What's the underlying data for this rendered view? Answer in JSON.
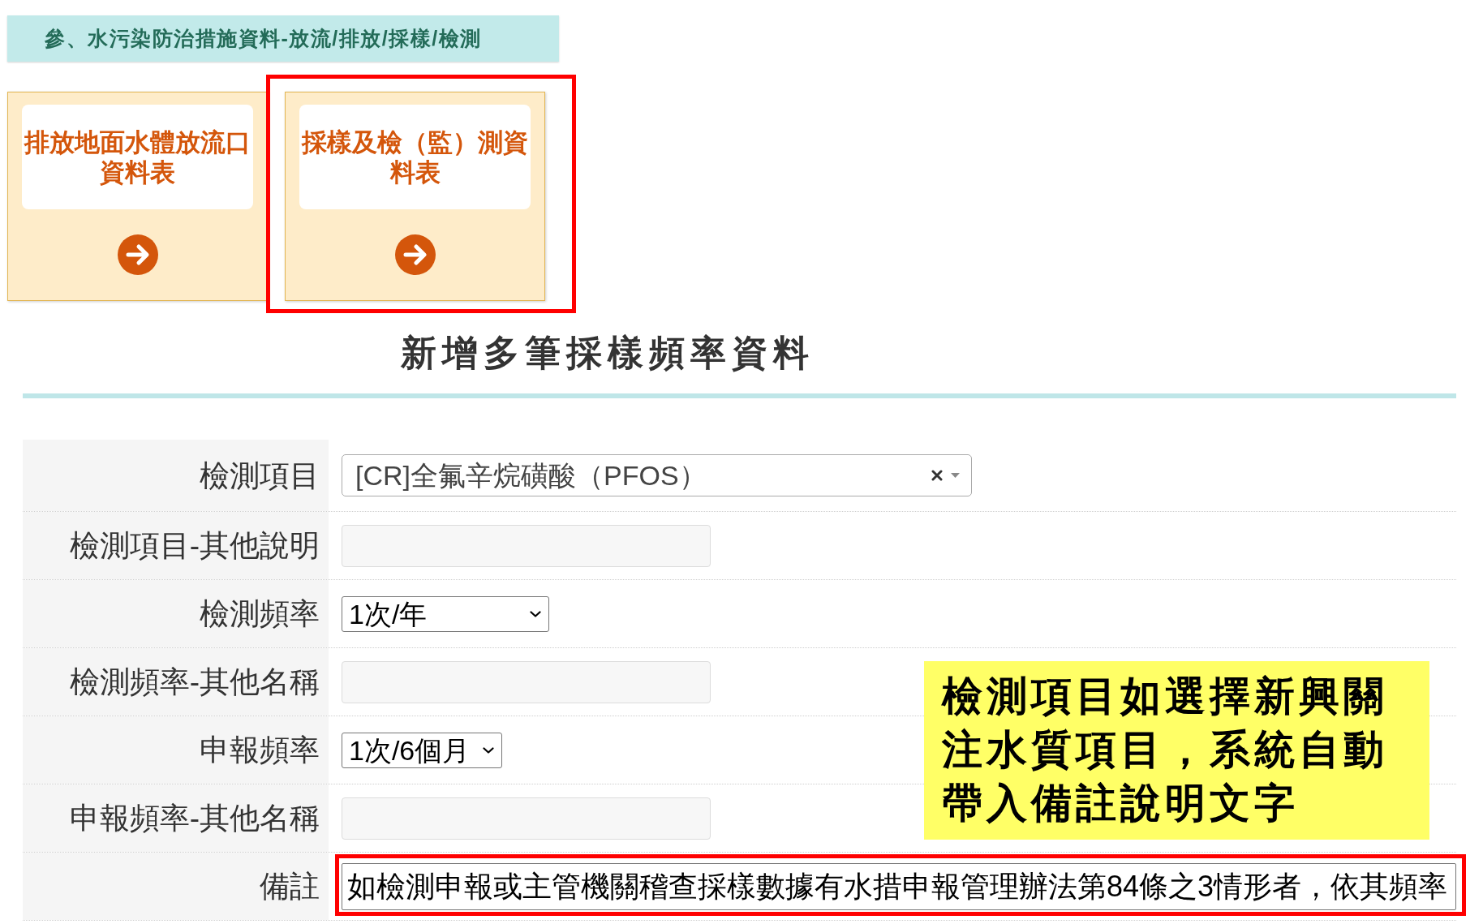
{
  "section_header": "參、水污染防治措施資料-放流/排放/採樣/檢測",
  "cards": [
    {
      "title": "排放地面水體放流口資料表",
      "highlighted": false
    },
    {
      "title": "採樣及檢（監）測資料表",
      "highlighted": true
    }
  ],
  "form": {
    "title": "新增多筆採樣頻率資料",
    "rows": [
      {
        "label": "檢測項目",
        "kind": "combobox",
        "value": "[CR]全氟辛烷磺酸（PFOS）",
        "highlighted": false
      },
      {
        "label": "檢測項目-其他說明",
        "kind": "text",
        "disabled": true,
        "highlighted": false
      },
      {
        "label": "檢測頻率",
        "kind": "select",
        "value": "1次/年",
        "highlighted": false
      },
      {
        "label": "檢測頻率-其他名稱",
        "kind": "text",
        "disabled": true,
        "highlighted": false
      },
      {
        "label": "申報頻率",
        "kind": "select",
        "value": "1次/6個月",
        "highlighted": false
      },
      {
        "label": "申報頻率-其他名稱",
        "kind": "text",
        "disabled": true,
        "highlighted": false
      },
      {
        "label": "備註",
        "kind": "text",
        "disabled": false,
        "value": "如檢測申報或主管機關稽查採樣數據有水措申報管理辦法第84條之3情形者，依其頻率",
        "highlighted": true
      }
    ]
  },
  "note": "檢測項目如選擇新興關注水質項目，系統自動帶入備註說明文字"
}
